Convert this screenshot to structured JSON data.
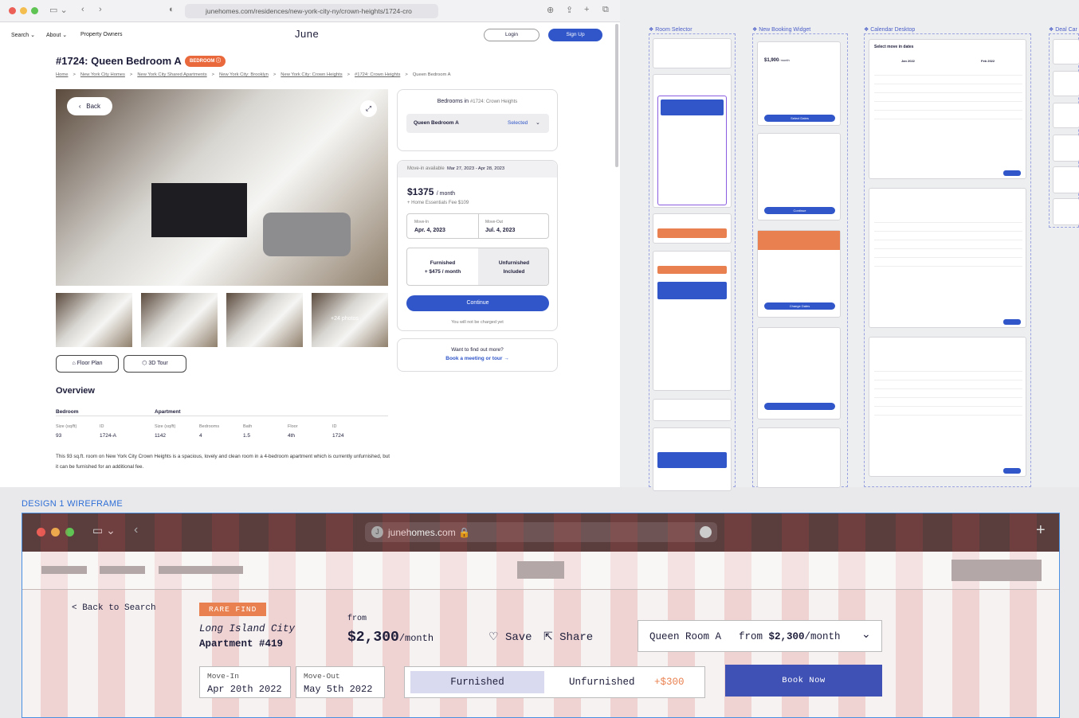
{
  "browser": {
    "url": "junehomes.com/residences/new-york-city-ny/crown-heights/1724-cro"
  },
  "nav": {
    "search": "Search",
    "about": "About",
    "owners": "Property Owners",
    "brand": "June",
    "login": "Login",
    "signup": "Sign Up"
  },
  "listing": {
    "title": "#1724: Queen Bedroom A",
    "badge": "BEDROOM",
    "breadcrumbs": [
      "Home",
      "New York City Homes",
      "New York City Shared Apartments",
      "New York City: Brooklyn",
      "New York City: Crown Heights",
      "#1724: Crown Heights",
      "Queen Bedroom A"
    ],
    "back": "Back",
    "photos_more": "+24 photos",
    "floor_plan": "Floor Plan",
    "tour": "3D Tour",
    "overview_title": "Overview",
    "bedroom_head": "Bedroom",
    "apartment_head": "Apartment",
    "facts": [
      {
        "label": "Size (sq/ft)",
        "value": "93"
      },
      {
        "label": "ID",
        "value": "1724-A"
      },
      {
        "label": "Size (sq/ft)",
        "value": "1142"
      },
      {
        "label": "Bedrooms",
        "value": "4"
      },
      {
        "label": "Bath",
        "value": "1.5"
      },
      {
        "label": "Floor",
        "value": "4th"
      },
      {
        "label": "ID",
        "value": "1724"
      }
    ],
    "description": "This 93 sq.ft. room on New York City Crown Heights is a spacious, lovely and clean room in a 4-bedroom apartment which is currently unfurnished, but it can be furnished for an additional fee."
  },
  "booking": {
    "bedrooms_in": "Bedrooms in",
    "bedrooms_place": "#1724: Crown Heights",
    "room": "Queen Bedroom A",
    "selected": "Selected",
    "avail_label": "Move-in available",
    "avail_range": "Mar 27, 2023 - Apr 28, 2023",
    "price": "$1375",
    "per": "/ month",
    "fee": "+ Home Essentials Fee $109",
    "movein_label": "Move-In",
    "movein": "Apr. 4, 2023",
    "moveout_label": "Move-Out",
    "moveout": "Jul. 4, 2023",
    "furnished": "Furnished",
    "furnished_price": "+ $475 / month",
    "unfurnished": "Unfurnished",
    "included": "Included",
    "continue": "Continue",
    "note": "You will not be charged yet",
    "more_q": "Want to find out more?",
    "meeting": "Book a meeting or tour →"
  },
  "canvas": {
    "room_selector": "Room Selector",
    "new_booking": "New Booking Widget",
    "calendar": "Calendar Desktop",
    "deal": "Deal Car",
    "select_dates": "Select move in dates",
    "jan": "Jan 2022",
    "feb": "Feb 2022",
    "price_a": "$1,900",
    "per_month": "/ month",
    "select_btn": "Select Dates",
    "continue": "Continue",
    "change_dates": "Change Dates"
  },
  "wireframe": {
    "label": "DESIGN 1 WIREFRAME",
    "url": "junehomes.com",
    "back": "< Back to Search",
    "rare": "RARE FIND",
    "city": "Long Island City",
    "apt": "Apartment #419",
    "from": "from",
    "price": "$2,300",
    "per": "/month",
    "save": "Save",
    "share": "Share",
    "room": "Queen Room A",
    "room_from": "from",
    "room_price": "$2,300",
    "room_per": "/month",
    "movein_label": "Move-In",
    "movein": "Apr 20th 2022",
    "moveout_label": "Move-Out",
    "moveout": "May 5th 2022",
    "furnished": "Furnished",
    "unfurnished": "Unfurnished",
    "extra": "+$300",
    "book": "Book Now"
  }
}
